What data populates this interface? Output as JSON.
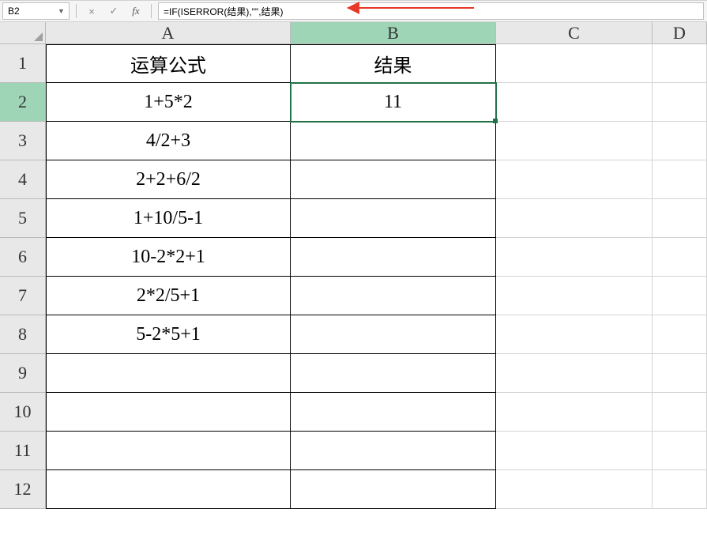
{
  "nameBox": "B2",
  "formula": "=IF(ISERROR(结果),\"\",结果)",
  "columns": [
    "A",
    "B",
    "C",
    "D"
  ],
  "rows": [
    "1",
    "2",
    "3",
    "4",
    "5",
    "6",
    "7",
    "8",
    "9",
    "10",
    "11",
    "12"
  ],
  "activeCell": "B2",
  "selectedColHeader": "B",
  "selectedRowHeader": "2",
  "cells": {
    "A1": "运算公式",
    "B1": "结果",
    "A2": "1+5*2",
    "B2": "11",
    "A3": "4/2+3",
    "A4": "2+2+6/2",
    "A5": "1+10/5-1",
    "A6": "10-2*2+1",
    "A7": "2*2/5+1",
    "A8": "5-2*5+1"
  },
  "buttons": {
    "cancel": "×",
    "confirm": "✓",
    "fx": "fx"
  }
}
